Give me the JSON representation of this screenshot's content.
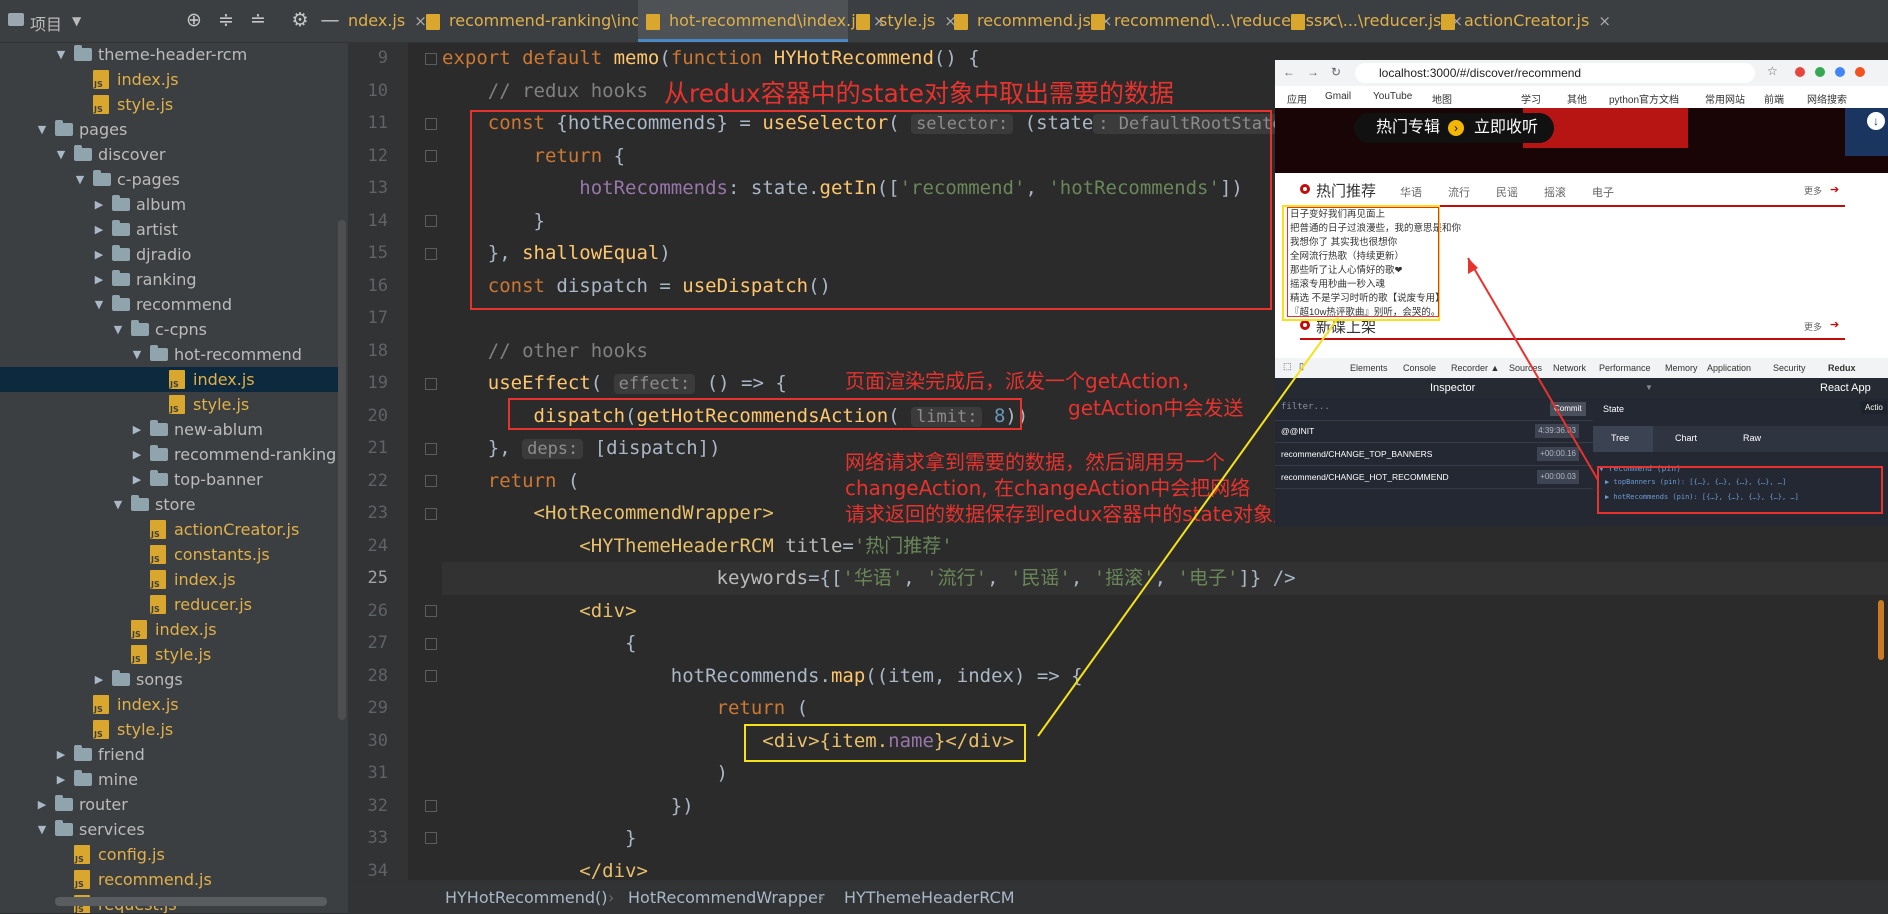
{
  "sidebar": {
    "title": "项目",
    "tree": [
      {
        "label": "theme-header-rcm",
        "type": "folder",
        "depth": 2,
        "expanded": true
      },
      {
        "label": "index.js",
        "type": "file",
        "depth": 3
      },
      {
        "label": "style.js",
        "type": "file",
        "depth": 3
      },
      {
        "label": "pages",
        "type": "folder",
        "depth": 1,
        "expanded": true
      },
      {
        "label": "discover",
        "type": "folder",
        "depth": 2,
        "expanded": true
      },
      {
        "label": "c-pages",
        "type": "folder",
        "depth": 3,
        "expanded": true
      },
      {
        "label": "album",
        "type": "folder",
        "depth": 4,
        "expanded": false
      },
      {
        "label": "artist",
        "type": "folder",
        "depth": 4,
        "expanded": false
      },
      {
        "label": "djradio",
        "type": "folder",
        "depth": 4,
        "expanded": false
      },
      {
        "label": "ranking",
        "type": "folder",
        "depth": 4,
        "expanded": false
      },
      {
        "label": "recommend",
        "type": "folder",
        "depth": 4,
        "expanded": true
      },
      {
        "label": "c-cpns",
        "type": "folder",
        "depth": 5,
        "expanded": true
      },
      {
        "label": "hot-recommend",
        "type": "folder",
        "depth": 6,
        "expanded": true
      },
      {
        "label": "index.js",
        "type": "file",
        "depth": 7,
        "selected": true
      },
      {
        "label": "style.js",
        "type": "file",
        "depth": 7
      },
      {
        "label": "new-ablum",
        "type": "folder",
        "depth": 6,
        "expanded": false
      },
      {
        "label": "recommend-ranking",
        "type": "folder",
        "depth": 6,
        "expanded": false
      },
      {
        "label": "top-banner",
        "type": "folder",
        "depth": 6,
        "expanded": false
      },
      {
        "label": "store",
        "type": "folder",
        "depth": 5,
        "expanded": true
      },
      {
        "label": "actionCreator.js",
        "type": "file",
        "depth": 6
      },
      {
        "label": "constants.js",
        "type": "file",
        "depth": 6
      },
      {
        "label": "index.js",
        "type": "file",
        "depth": 6
      },
      {
        "label": "reducer.js",
        "type": "file",
        "depth": 6
      },
      {
        "label": "index.js",
        "type": "file",
        "depth": 5
      },
      {
        "label": "style.js",
        "type": "file",
        "depth": 5
      },
      {
        "label": "songs",
        "type": "folder",
        "depth": 4,
        "expanded": false
      },
      {
        "label": "index.js",
        "type": "file",
        "depth": 3
      },
      {
        "label": "style.js",
        "type": "file",
        "depth": 3
      },
      {
        "label": "friend",
        "type": "folder",
        "depth": 2,
        "expanded": false
      },
      {
        "label": "mine",
        "type": "folder",
        "depth": 2,
        "expanded": false
      },
      {
        "label": "router",
        "type": "folder",
        "depth": 1,
        "expanded": false
      },
      {
        "label": "services",
        "type": "folder",
        "depth": 1,
        "expanded": true
      },
      {
        "label": "config.js",
        "type": "file",
        "depth": 2
      },
      {
        "label": "recommend.js",
        "type": "file",
        "depth": 2
      },
      {
        "label": "request.js",
        "type": "file",
        "depth": 2
      }
    ]
  },
  "tabs": [
    {
      "label": "ndex.js"
    },
    {
      "label": "recommend-ranking\\index.js"
    },
    {
      "label": "hot-recommend\\index.js",
      "active": true
    },
    {
      "label": "style.js"
    },
    {
      "label": "recommend.js"
    },
    {
      "label": "recommend\\...\\reducer.js"
    },
    {
      "label": "src\\...\\reducer.js"
    },
    {
      "label": "actionCreator.js"
    }
  ],
  "editor": {
    "line_numbers": [
      "9",
      "10",
      "11",
      "12",
      "13",
      "14",
      "15",
      "16",
      "17",
      "18",
      "19",
      "20",
      "21",
      "22",
      "23",
      "24",
      "25",
      "26",
      "27",
      "28",
      "29",
      "30",
      "31",
      "32",
      "33",
      "34"
    ],
    "current_line": "25",
    "code": {
      "l9": {
        "kw1": "export default ",
        "fn1": "memo",
        "p1": "(",
        "kw2": "function ",
        "fn2": "HYHotRecommend",
        "p2": "() {"
      },
      "l10": {
        "cm": "// redux hooks"
      },
      "l11": {
        "kw": "const ",
        "p1": "{hotRecommends} = ",
        "fn": "useSelector",
        "p2": "(",
        "hint1": "selector:",
        "p3": " (state",
        "hint2": ": DefaultRootState",
        "p4": " ) => {"
      },
      "l12": {
        "kw": "return ",
        "p": "{"
      },
      "l13": {
        "pr": "hotRecommends",
        "p1": ": state.",
        "fn": "getIn",
        "p2": "([",
        "s1": "'recommend'",
        "p3": ", ",
        "s2": "'hotRecommends'",
        "p4": "])"
      },
      "l14": {
        "p": "}"
      },
      "l15": {
        "p1": "}, ",
        "fn": "shallowEqual",
        "p2": ")"
      },
      "l16": {
        "kw": "const ",
        "p1": "dispatch = ",
        "fn": "useDispatch",
        "p2": "()"
      },
      "l17": {},
      "l18": {
        "cm": "// other hooks"
      },
      "l19": {
        "fn": "useEffect",
        "p1": "(",
        "hint": "effect:",
        "p2": " () => {"
      },
      "l20": {
        "fn1": "dispatch",
        "p1": "(",
        "fn2": "getHotRecommendsAction",
        "p2": "(",
        "hint": "limit:",
        "num": "8",
        "p3": "))"
      },
      "l21": {
        "p1": "}, ",
        "hint": "deps:",
        "p2": " [dispatch])"
      },
      "l22": {
        "kw": "return ",
        "p": "("
      },
      "l23": {
        "t1": "<",
        "tg": "HotRecommendWrapper",
        "t2": ">"
      },
      "l24": {
        "t1": "<",
        "tg": "HYThemeHeaderRCM",
        "at": " title",
        "p": "=",
        "s": "'热门推荐'"
      },
      "l25": {
        "at": "keywords",
        "p1": "={[",
        "s1": "'华语'",
        "c1": ", ",
        "s2": "'流行'",
        "c2": ", ",
        "s3": "'民谣'",
        "c3": ", ",
        "s4": "'摇滚'",
        "c4": ", ",
        "s5": "'电子'",
        "p2": "]} />"
      },
      "l26": {
        "t1": "<",
        "tg": "div",
        "t2": ">"
      },
      "l27": {
        "p": "{"
      },
      "l28": {
        "p1": "hotRecommends.",
        "fn": "map",
        "p2": "((item, ",
        "pr": "index",
        "p3": ") => {"
      },
      "l29": {
        "kw": "return ",
        "p": "("
      },
      "l30": {
        "t1": "<",
        "tg1": "div",
        "t2": ">{item.",
        "pr": "name",
        "t3": "}</",
        "tg2": "div",
        "t4": ">"
      },
      "l31": {
        "p": ")"
      },
      "l32": {
        "p": "})"
      },
      "l33": {
        "p": "}"
      },
      "l34": {
        "t1": "</",
        "tg": "div",
        "t2": ">"
      }
    }
  },
  "breadcrumb": [
    "HYHotRecommend()",
    "HotRecommendWrapper",
    "HYThemeHeaderRCM"
  ],
  "annotations": {
    "a1": "从redux容器中的state对象中取出需要的数据",
    "a2a": "页面渲染完成后，派发一个getAction，",
    "a2b": "getAction中会发送",
    "a3a": "网络请求拿到需要的数据，然后调用另一个",
    "a3b": "changeAction, 在changeAction中会把网络",
    "a3c": "请求返回的数据保存到redux容器中的state对象里面。"
  },
  "browser": {
    "url": "localhost:3000/#/discover/recommend",
    "bookmarks": [
      "应用",
      "Gmail",
      "YouTube",
      "地图",
      "学习",
      "其他",
      "python官方文档",
      "常用网站",
      "前端",
      "网络搜索"
    ],
    "banner_button": "热门专辑",
    "banner_button2": "立即收听",
    "hot_title": "热门推荐",
    "hot_keywords": [
      "华语",
      "流行",
      "民谣",
      "摇滚",
      "电子"
    ],
    "more": "更多",
    "hot_list": [
      "日子变好我们再见面上",
      "把普通的日子过浪漫些，我的意思是和你",
      "我想你了 其实我也很想你",
      "全网流行热歌（持续更新）",
      "那些听了让人心情好的歌❤",
      "摇滚专用秒曲一秒入魂",
      "精选 不是学习时听的歌【说废专用】",
      "『超10w热评歌曲』别听，会哭的。"
    ],
    "new_title": "新碟上架",
    "devtools_tabs": [
      "Elements",
      "Console",
      "Recorder ▲",
      "Sources",
      "Network",
      "Performance",
      "Memory",
      "Application",
      "Security",
      "Redux"
    ],
    "inspector": "Inspector",
    "react_app": "React App",
    "filter": "filter...",
    "commit": "Commit",
    "actions": [
      {
        "name": "@@INIT",
        "time": "4:39:36.03"
      },
      {
        "name": "recommend/CHANGE_TOP_BANNERS",
        "time": "+00:00.16"
      },
      {
        "name": "recommend/CHANGE_HOT_RECOMMEND",
        "time": "+00:00.03"
      }
    ],
    "state_label": "State",
    "action_label": "Actio",
    "state_tabs": [
      "Tree",
      "Chart",
      "Raw"
    ],
    "state_tree": {
      "root": "▼ recommend (pin)",
      "item1": "▶ topBanners (pin): [{…}, {…}, {…}, {…}, …]",
      "item2": "▶ hotRecommends (pin): [{…}, {…}, {…}, {…}, …]"
    }
  },
  "colors": {
    "accent": "#4a88c7",
    "annotation_red": "#e8322d",
    "annotation_yellow": "#f5e21a",
    "editor_bg": "#2b2b2b",
    "sidebar_bg": "#3c3f41"
  }
}
